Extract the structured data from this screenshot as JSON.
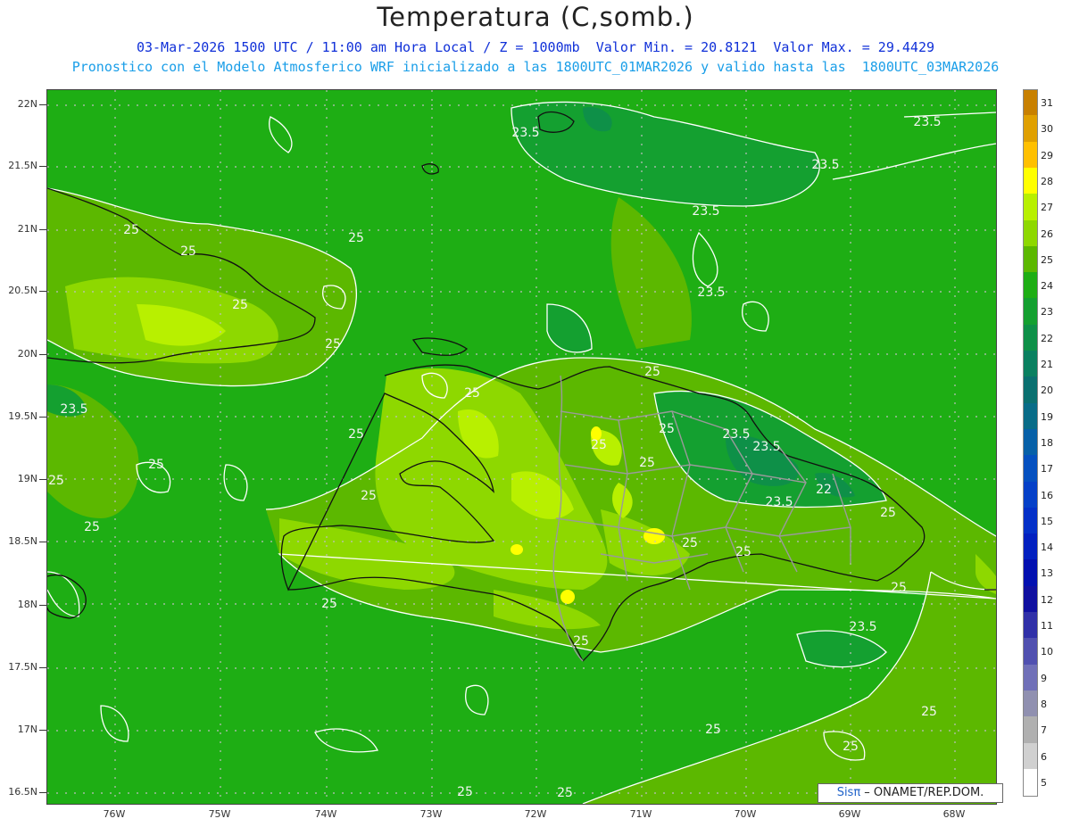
{
  "title": "Temperatura (C,somb.)",
  "subtitle_line1": "03-Mar-2026 1500 UTC / 11:00 am Hora Local / Z = 1000mb  Valor Min. = 20.8121  Valor Max. = 29.4429",
  "subtitle_line2": "Pronostico con el Modelo Atmosferico WRF inicializado a las 1800UTC_01MAR2026 y valido hasta las  1800UTC_03MAR2026",
  "credit": {
    "brand": "Sisπ",
    "text": " – ONAMET/REP.DOM."
  },
  "axes": {
    "lat_labels": [
      "22N",
      "21.5N",
      "21N",
      "20.5N",
      "20N",
      "19.5N",
      "19N",
      "18.5N",
      "18N",
      "17.5N",
      "17N",
      "16.5N"
    ],
    "lon_labels": [
      "76W",
      "75W",
      "74W",
      "73W",
      "72W",
      "71W",
      "70W",
      "69W",
      "68W"
    ]
  },
  "colorbar": {
    "labels": [
      "31",
      "30",
      "29",
      "28",
      "27",
      "26",
      "25",
      "24",
      "23",
      "22",
      "21",
      "20",
      "19",
      "18",
      "17",
      "16",
      "15",
      "14",
      "13",
      "12",
      "11",
      "10",
      "9",
      "8",
      "7",
      "6",
      "5"
    ],
    "colors": [
      "#c88000",
      "#e0a000",
      "#ffc000",
      "#ffff00",
      "#b8f000",
      "#8ed800",
      "#5cb800",
      "#1eae14",
      "#14a030",
      "#0e9048",
      "#0a8060",
      "#0a7070",
      "#086c88",
      "#0660a8",
      "#0450c0",
      "#0440c8",
      "#0330c8",
      "#0220c0",
      "#0210b0",
      "#1010a0",
      "#3030a8",
      "#5050b0",
      "#7070b8",
      "#9090b0",
      "#b0b0b0",
      "#d0d0d0",
      "#ffffff"
    ]
  },
  "contour_labels": [
    "23.5",
    "23.5",
    "23.5",
    "23.5",
    "23.5",
    "25",
    "25",
    "25",
    "25",
    "25",
    "25",
    "23.5",
    "25",
    "25",
    "25",
    "25",
    "25",
    "25",
    "25",
    "25",
    "23.5",
    "25",
    "23.5",
    "22",
    "22",
    "23.5",
    "25",
    "25",
    "25",
    "25",
    "25",
    "25",
    "23.5",
    "25",
    "25",
    "25",
    "25",
    "25",
    "25"
  ],
  "colors": {
    "contour_line": "#ffffff",
    "coast": "#111111",
    "borders": "#9a9a9a",
    "grid": "#bfbfbf"
  }
}
